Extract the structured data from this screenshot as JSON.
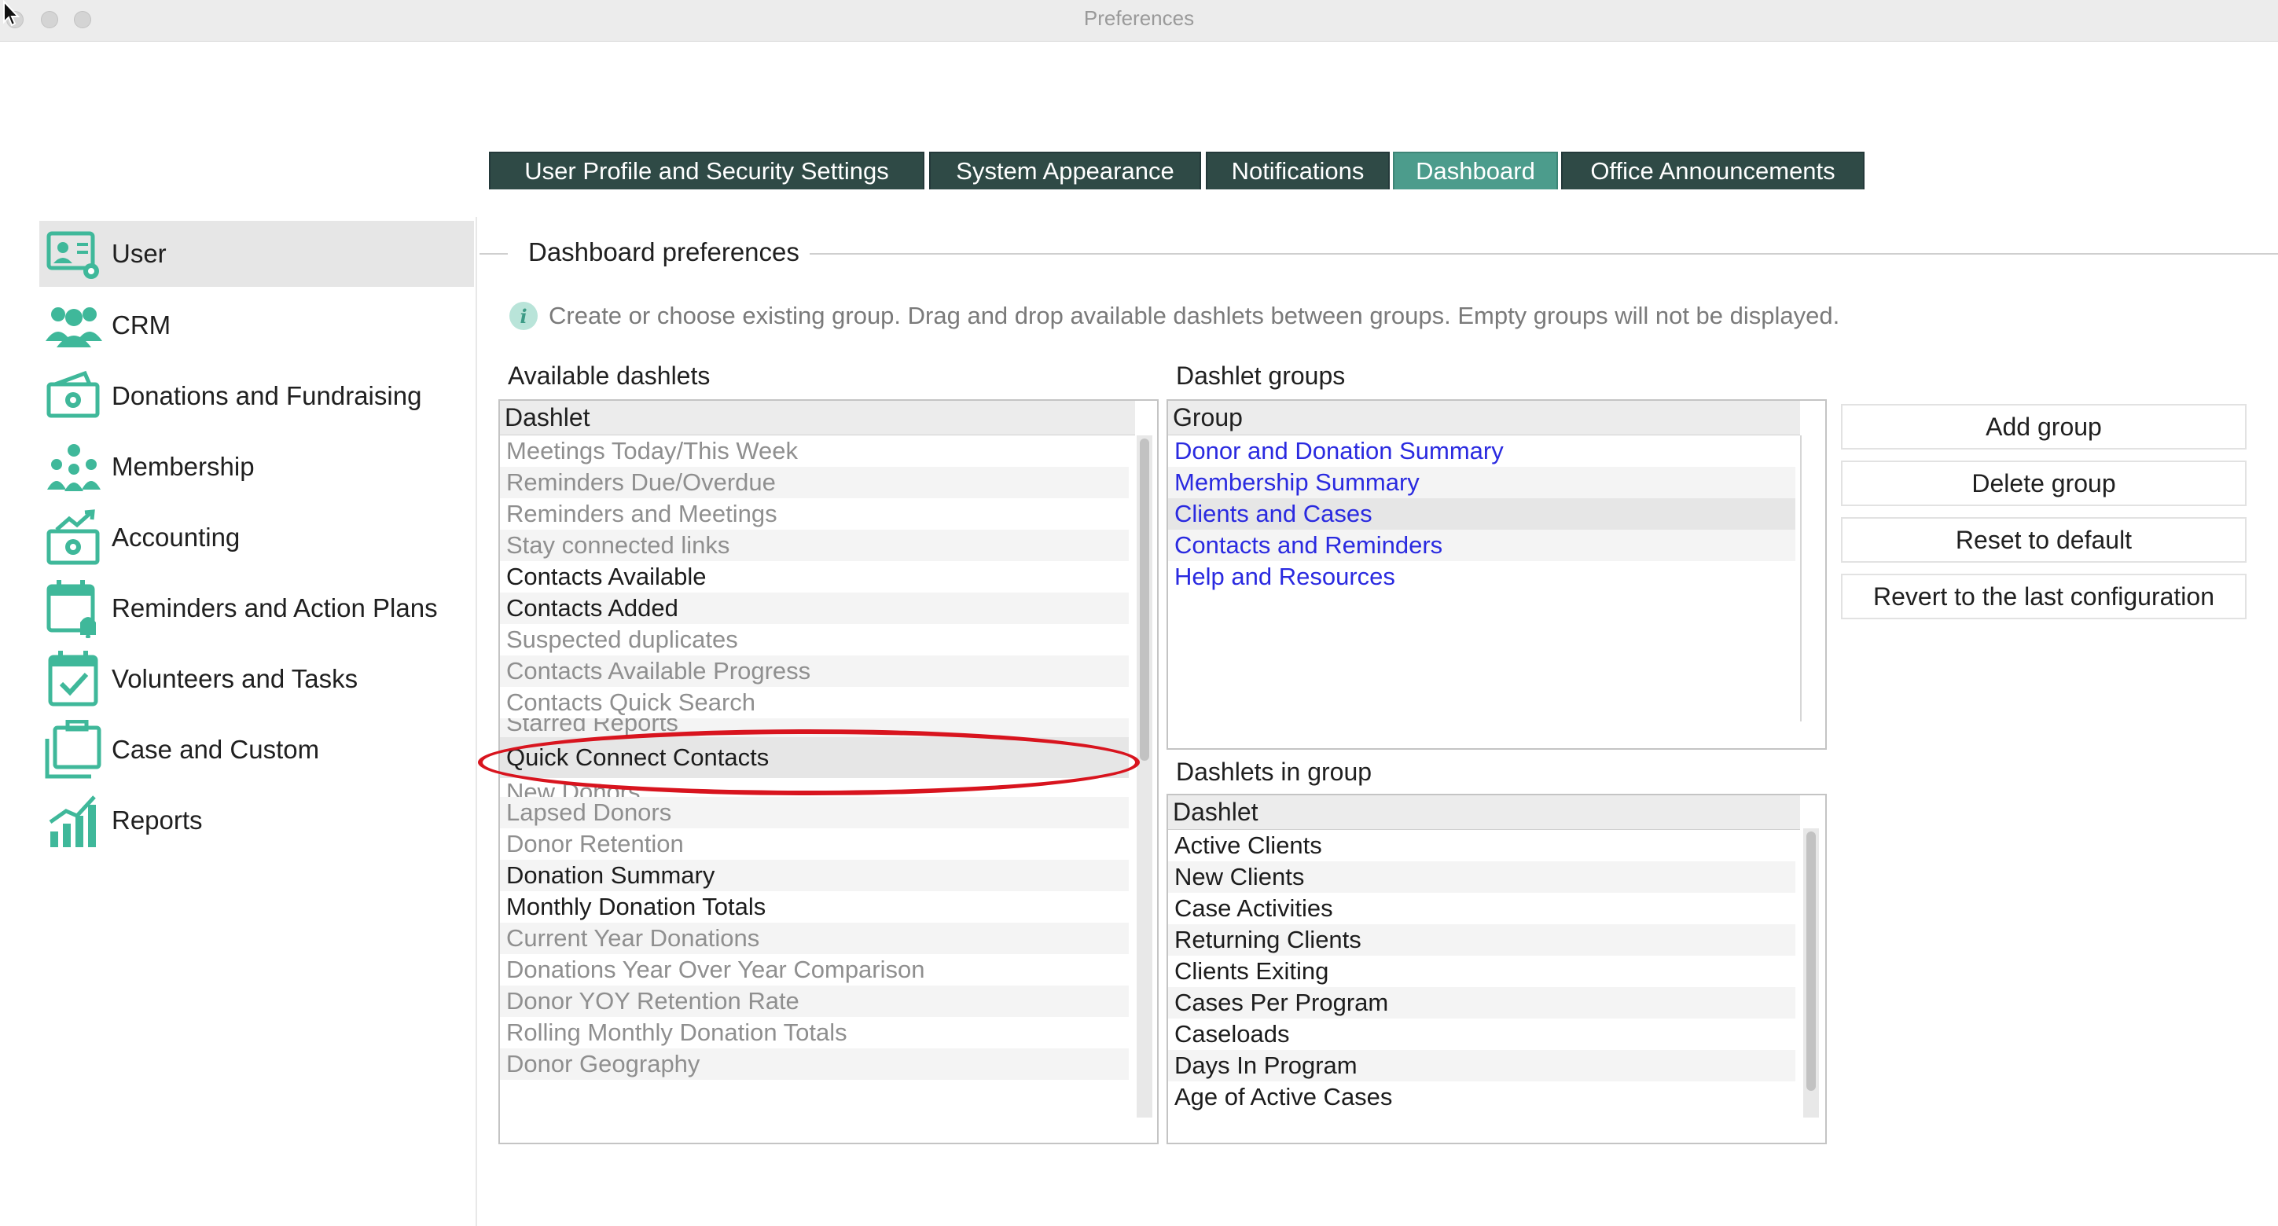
{
  "window": {
    "title": "Preferences"
  },
  "sidebar": {
    "items": [
      {
        "label": "User",
        "icon": "user-card-icon"
      },
      {
        "label": "CRM",
        "icon": "people-group-icon"
      },
      {
        "label": "Donations and Fundraising",
        "icon": "money-icon"
      },
      {
        "label": "Membership",
        "icon": "membership-people-icon"
      },
      {
        "label": "Accounting",
        "icon": "accounting-money-icon"
      },
      {
        "label": "Reminders and Action Plans",
        "icon": "calendar-bell-icon"
      },
      {
        "label": "Volunteers and Tasks",
        "icon": "calendar-check-icon"
      },
      {
        "label": "Case and Custom",
        "icon": "folders-icon"
      },
      {
        "label": "Reports",
        "icon": "bar-chart-icon"
      }
    ],
    "selected": "User"
  },
  "tabs": [
    {
      "label": "User Profile and Security Settings"
    },
    {
      "label": "System Appearance"
    },
    {
      "label": "Notifications"
    },
    {
      "label": "Dashboard"
    },
    {
      "label": "Office Announcements"
    }
  ],
  "active_tab": "Dashboard",
  "dashboard": {
    "group_title": "Dashboard preferences",
    "info_text": "Create or choose existing group. Drag and drop available dashlets between groups. Empty groups will not be displayed.",
    "available": {
      "label": "Available dashlets",
      "header": "Dashlet",
      "items": [
        {
          "text": "Meetings Today/This Week",
          "active": false
        },
        {
          "text": "Reminders Due/Overdue",
          "active": false
        },
        {
          "text": "Reminders and Meetings",
          "active": false
        },
        {
          "text": "Stay connected links",
          "active": false
        },
        {
          "text": "Contacts Available",
          "active": true
        },
        {
          "text": "Contacts Added",
          "active": true
        },
        {
          "text": "Suspected duplicates",
          "active": false
        },
        {
          "text": "Contacts Available Progress",
          "active": false
        },
        {
          "text": "Contacts Quick Search",
          "active": false
        },
        {
          "text": "Starred Reports",
          "active": false
        },
        {
          "text": "Quick Connect Contacts",
          "active": true
        },
        {
          "text": "New Donors",
          "active": false
        },
        {
          "text": "Lapsed Donors",
          "active": false
        },
        {
          "text": "Donor Retention",
          "active": false
        },
        {
          "text": "Donation Summary",
          "active": true
        },
        {
          "text": "Monthly Donation Totals",
          "active": true
        },
        {
          "text": "Current Year Donations",
          "active": false
        },
        {
          "text": "Donations Year Over Year Comparison",
          "active": false
        },
        {
          "text": "Donor YOY Retention Rate",
          "active": false
        },
        {
          "text": "Rolling Monthly Donation Totals",
          "active": false
        },
        {
          "text": "Donor Geography",
          "active": false
        }
      ]
    },
    "groups": {
      "label": "Dashlet groups",
      "header": "Group",
      "items": [
        "Donor and Donation Summary",
        "Membership Summary",
        "Clients and Cases",
        "Contacts and Reminders",
        "Help and Resources"
      ],
      "selected": "Clients and Cases"
    },
    "in_group": {
      "label": "Dashlets in group",
      "header": "Dashlet",
      "items": [
        "Active Clients",
        "New Clients",
        "Case Activities",
        "Returning Clients",
        "Clients Exiting",
        "Cases Per Program",
        "Caseloads",
        "Days In Program",
        "Age of Active Cases"
      ]
    },
    "buttons": {
      "add": "Add group",
      "delete": "Delete group",
      "reset": "Reset to default",
      "revert": "Revert to the last configuration"
    }
  },
  "colors": {
    "accent": "#3fb89a",
    "tab_bg": "#2f4a46",
    "tab_active": "#4c9c8c",
    "link_blue": "#2a2ae0",
    "highlight_red": "#d8141e"
  }
}
